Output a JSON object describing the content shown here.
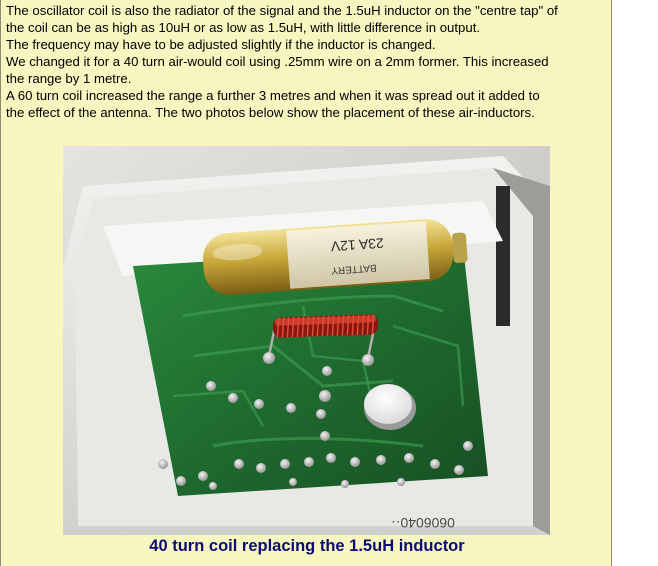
{
  "article": {
    "lines": [
      "The oscillator coil is also the radiator of the signal and the 1.5uH inductor on the \"centre tap\" of",
      "the coil can be as high as 10uH or as low as 1.5uH, with little difference in output.",
      "The frequency may have to be adjusted slightly if the inductor is changed.",
      "We changed it for a 40 turn air-would coil using .25mm wire on a 2mm former. This increased",
      "the range by 1 metre.",
      "A 60 turn coil increased the range a further 3 metres and when it was spread out it added to",
      "the effect of the antenna. The two photos below show the placement of these air-inductors."
    ]
  },
  "photo": {
    "battery_label_1": "23A 12V",
    "battery_label_2": "BATTERY",
    "case_text": "0606040··"
  },
  "caption": "40 turn coil replacing the 1.5uH inductor",
  "colors": {
    "panel_background": "#f7f6c0",
    "caption": "#0b0b78",
    "pcb_green": "#1f6b2f",
    "coil_copper": "#c0281c",
    "battery_gold": "#c9a83a"
  }
}
